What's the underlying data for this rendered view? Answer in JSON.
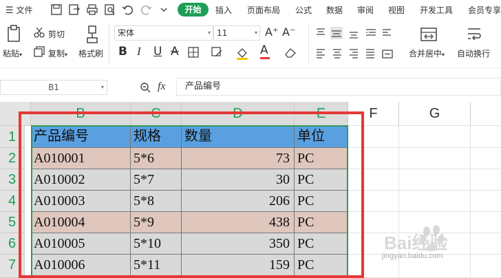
{
  "menubar": {
    "hamburger_label": "文件",
    "tabs": [
      {
        "label": "开始",
        "active": true
      },
      {
        "label": "插入"
      },
      {
        "label": "页面布局"
      },
      {
        "label": "公式"
      },
      {
        "label": "数据"
      },
      {
        "label": "审阅"
      },
      {
        "label": "视图"
      },
      {
        "label": "开发工具"
      },
      {
        "label": "会员专享"
      }
    ]
  },
  "ribbon": {
    "paste_label": "粘贴",
    "cut_label": "剪切",
    "copy_label": "复制",
    "format_painter_label": "格式刷",
    "font_name": "宋体",
    "font_size": "11",
    "merge_label": "合并居中",
    "wrap_label": "自动换行"
  },
  "formula_bar": {
    "name_box": "B1",
    "fx_label": "fx",
    "content": "产品编号"
  },
  "grid": {
    "columns": [
      "B",
      "C",
      "D",
      "E",
      "F",
      "G"
    ],
    "rows": [
      "1",
      "2",
      "3",
      "4",
      "5",
      "6",
      "7"
    ],
    "headers": [
      "产品编号",
      "规格",
      "数量",
      "单位"
    ],
    "data": [
      [
        "A010001",
        "5*6",
        "73",
        "PC"
      ],
      [
        "A010002",
        "5*7",
        "30",
        "PC"
      ],
      [
        "A010003",
        "5*8",
        "206",
        "PC"
      ],
      [
        "A010004",
        "5*9",
        "438",
        "PC"
      ],
      [
        "A010005",
        "5*10",
        "350",
        "PC"
      ],
      [
        "A010006",
        "5*11",
        "159",
        "PC"
      ]
    ]
  },
  "watermark": {
    "brand": "Bai经验",
    "url": "jingyan.baidu.com"
  },
  "colors": {
    "accent_green": "#1e9e57",
    "header_blue": "#5aa0e0",
    "row_tan": "#dfc7bd",
    "row_gray": "#d9d9d9",
    "highlight_red": "#e53935"
  }
}
